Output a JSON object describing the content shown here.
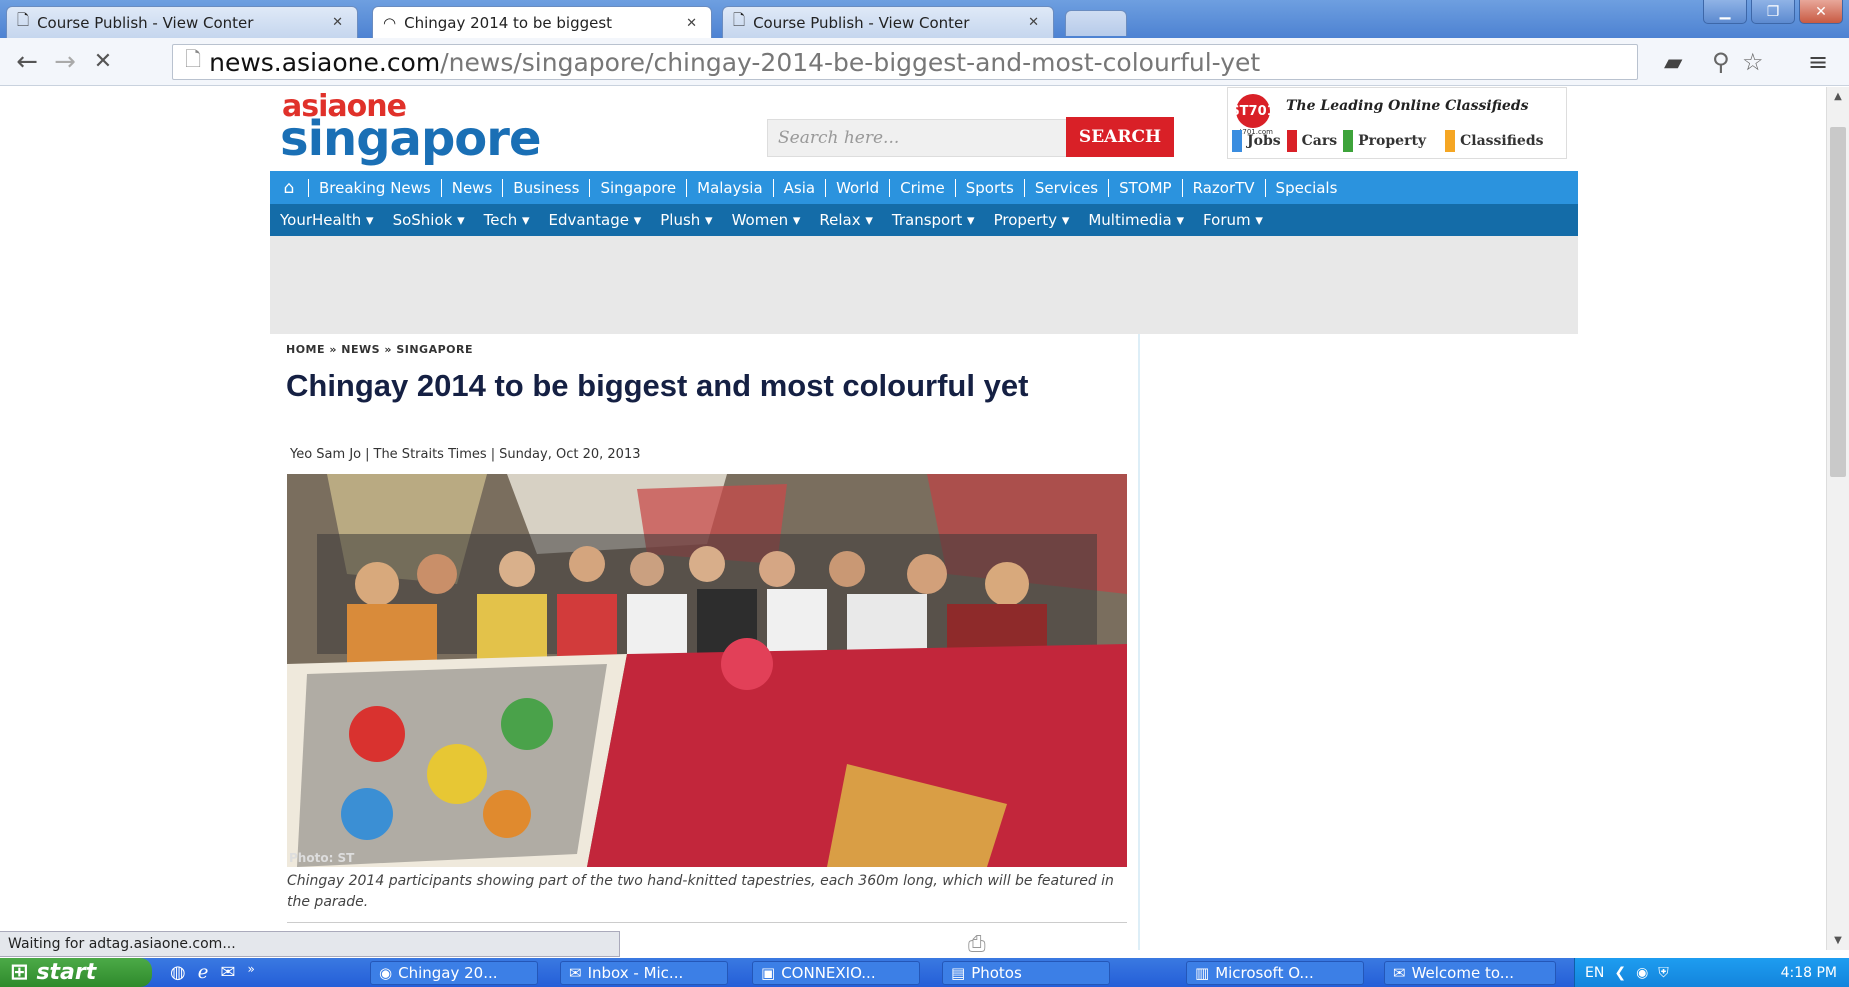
{
  "browser": {
    "tabs": [
      {
        "label": "Course Publish - View Conter"
      },
      {
        "label": "Chingay 2014 to be biggest"
      },
      {
        "label": "Course Publish - View Conter"
      }
    ],
    "url_host": "news.asiaone.com",
    "url_path": "/news/singapore/chingay-2014-be-biggest-and-most-colourful-yet",
    "status": "Waiting for adtag.asiaone.com..."
  },
  "site": {
    "logo_top": "asiaone",
    "logo_main": "singapore",
    "search_placeholder": "Search here...",
    "search_button": "SEARCH",
    "classifieds": {
      "brand": "ST701",
      "tagline": "st701.com",
      "title": "The Leading Online Classifieds",
      "links": [
        "Jobs",
        "Cars",
        "Property",
        "Classifieds"
      ]
    },
    "nav_primary": [
      "Breaking News",
      "News",
      "Business",
      "Singapore",
      "Malaysia",
      "Asia",
      "World",
      "Crime",
      "Sports",
      "Services",
      "STOMP",
      "RazorTV",
      "Specials"
    ],
    "nav_secondary": [
      "YourHealth ▾",
      "SoShiok ▾",
      "Tech ▾",
      "Edvantage ▾",
      "Plush ▾",
      "Women ▾",
      "Relax ▾",
      "Transport ▾",
      "Property ▾",
      "Multimedia ▾",
      "Forum ▾"
    ]
  },
  "article": {
    "breadcrumb": "HOME » NEWS » SINGAPORE",
    "title": "Chingay 2014 to be biggest and most colourful yet",
    "author": "Yeo Sam Jo",
    "source": "The Straits Times",
    "date": "Sunday, Oct 20, 2013",
    "photo_credit": "Photo: ST",
    "caption": "Chingay 2014 participants showing part of the two hand-knitted tapestries, each 360m long, which will be featured in the parade."
  },
  "taskbar": {
    "start": "start",
    "items": [
      "Chingay 20...",
      "Inbox - Mic...",
      "CONNEXIO...",
      "Photos",
      "Microsoft O...",
      "Welcome to..."
    ],
    "lang": "EN",
    "time": "4:18 PM"
  }
}
